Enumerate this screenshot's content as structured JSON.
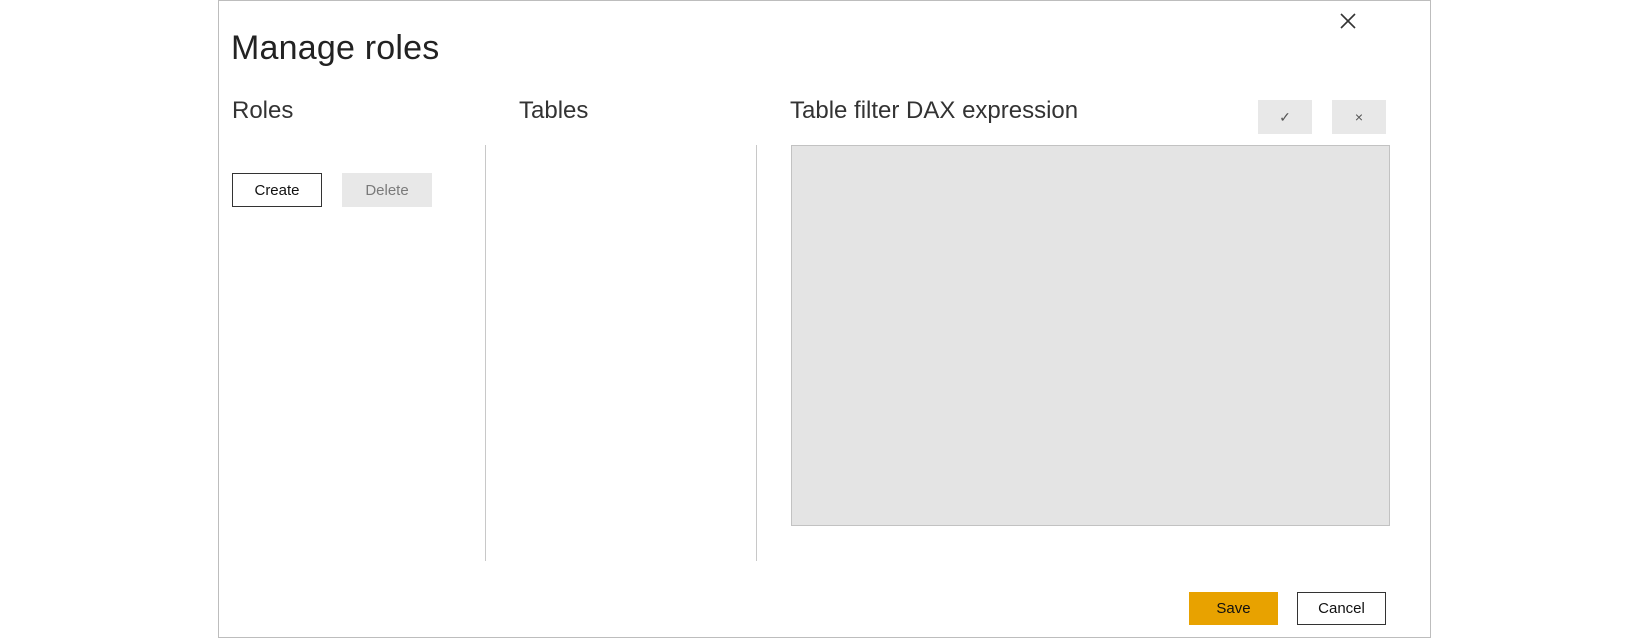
{
  "dialog": {
    "title": "Manage roles",
    "close_icon": "close-icon"
  },
  "roles": {
    "heading": "Roles",
    "create_label": "Create",
    "delete_label": "Delete"
  },
  "tables": {
    "heading": "Tables"
  },
  "dax": {
    "heading": "Table filter DAX expression",
    "commit_icon": "checkmark-icon",
    "discard_icon": "close-icon",
    "commit_glyph": "✓",
    "discard_glyph": "×",
    "expression": ""
  },
  "footer": {
    "save_label": "Save",
    "cancel_label": "Cancel"
  },
  "colors": {
    "save_accent": "#e8a200",
    "editor_bg": "#e4e4e4",
    "disabled_bg": "#e8e8e8"
  }
}
